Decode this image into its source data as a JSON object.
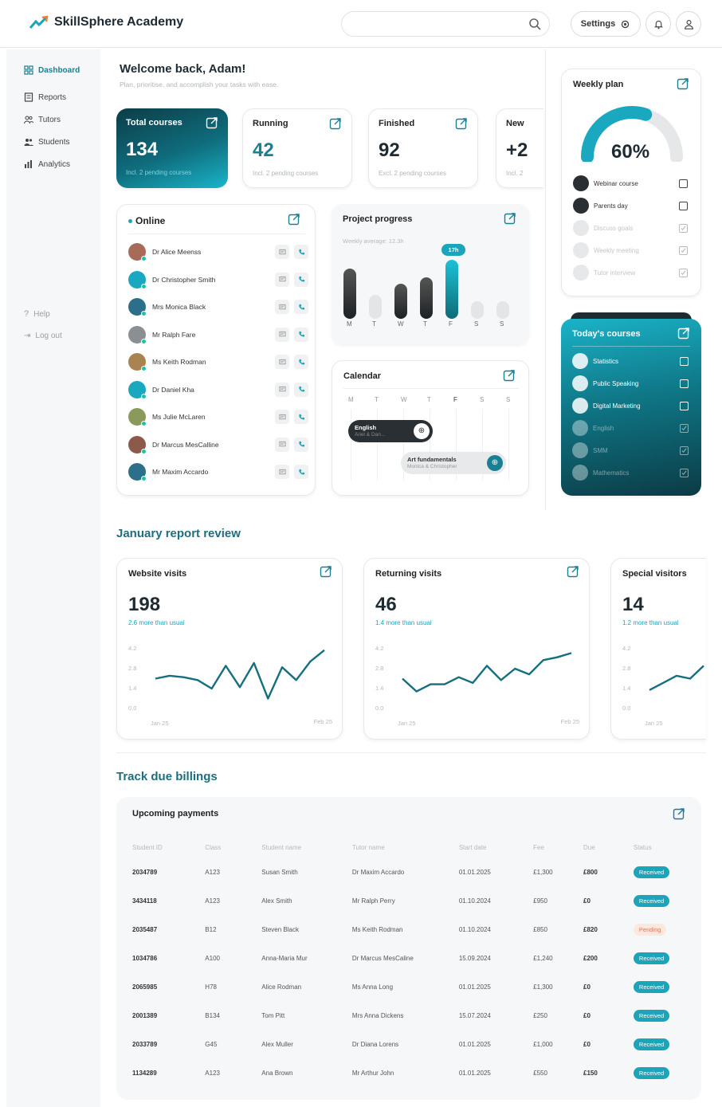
{
  "app": {
    "name": "SkillSphere Academy"
  },
  "header": {
    "settings_label": "Settings",
    "search_placeholder": ""
  },
  "sidebar": {
    "items": [
      {
        "label": "Dashboard",
        "icon": "grid-icon"
      },
      {
        "label": "Reports",
        "icon": "report-icon"
      },
      {
        "label": "Tutors",
        "icon": "tutors-icon"
      },
      {
        "label": "Students",
        "icon": "students-icon"
      },
      {
        "label": "Analytics",
        "icon": "analytics-icon"
      }
    ],
    "help": "Help",
    "logout": "Log out"
  },
  "welcome": {
    "title": "Welcome back, Adam!",
    "subtitle": "Plan, prioritise, and accomplish your tasks with ease."
  },
  "stats": [
    {
      "title": "Total courses",
      "value": "134",
      "sub": "Incl. 2 pending courses"
    },
    {
      "title": "Running",
      "value": "42",
      "sub": "Incl. 2 pending courses"
    },
    {
      "title": "Finished",
      "value": "92",
      "sub": "Excl. 2 pending courses"
    },
    {
      "title": "New",
      "value": "+2",
      "sub": "Incl. 2"
    }
  ],
  "online": {
    "title": "Online",
    "people": [
      {
        "name": "Dr Alice Meenss",
        "color": "#a86b5a"
      },
      {
        "name": "Dr Christopher Smith",
        "color": "#1aa8c0"
      },
      {
        "name": "Mrs Monica Black",
        "color": "#2b6f8a"
      },
      {
        "name": "Mr Ralph Fare",
        "color": "#8a8f93"
      },
      {
        "name": "Ms Keith Rodman",
        "color": "#a98350"
      },
      {
        "name": "Dr Daniel Kha",
        "color": "#1aa8c0"
      },
      {
        "name": "Ms Julie McLaren",
        "color": "#8a9a5a"
      },
      {
        "name": "Dr Marcus MesCalline",
        "color": "#8b5a4a"
      },
      {
        "name": "Mr Maxim Accardo",
        "color": "#2b6f8a"
      }
    ]
  },
  "project_progress": {
    "title": "Project progress",
    "subtitle": "Weekly average: 12.3h",
    "highlight": "17h",
    "days": [
      "M",
      "T",
      "W",
      "T",
      "F",
      "S",
      "S"
    ],
    "levels": [
      0.85,
      0.4,
      0.6,
      0.7,
      1.0,
      0.3,
      0.3
    ]
  },
  "calendar": {
    "title": "Calendar",
    "days": [
      "M",
      "T",
      "W",
      "T",
      "F",
      "S",
      "S"
    ],
    "events": [
      {
        "title": "English",
        "sub": "Ariel & Dan..."
      },
      {
        "title": "Art fundamentals",
        "sub": "Monica & Christopher"
      }
    ]
  },
  "weekly_plan": {
    "title": "Weekly plan",
    "percent_label": "60%",
    "percent": 60,
    "items": [
      {
        "label": "Webinar course",
        "done": false
      },
      {
        "label": "Parents day",
        "done": false
      },
      {
        "label": "Discuss goals",
        "done": true
      },
      {
        "label": "Weekly meeting",
        "done": true
      },
      {
        "label": "Tutor interview",
        "done": true
      }
    ]
  },
  "todays_courses": {
    "title": "Today's courses",
    "items": [
      {
        "label": "Statistics",
        "done": false
      },
      {
        "label": "Public Speaking",
        "done": false
      },
      {
        "label": "Digital Marketing",
        "done": false
      },
      {
        "label": "English",
        "done": true
      },
      {
        "label": "SMM",
        "done": true
      },
      {
        "label": "Mathematics",
        "done": true
      }
    ]
  },
  "report": {
    "title": "January report review",
    "cards": [
      {
        "title": "Website visits",
        "value": "198",
        "sub": "2.6 more than usual",
        "yticks": [
          "4.2",
          "2.8",
          "1.4",
          "0.0"
        ],
        "xstart": "Jan 25",
        "xend": "Feb 25",
        "points": [
          2.1,
          2.3,
          2.2,
          2.0,
          1.4,
          3.0,
          1.5,
          3.2,
          0.7,
          2.9,
          2.0,
          3.3,
          4.1
        ]
      },
      {
        "title": "Returning visits",
        "value": "46",
        "sub": "1.4 more than usual",
        "yticks": [
          "4.2",
          "2.8",
          "1.4",
          "0.0"
        ],
        "xstart": "Jan 25",
        "xend": "Feb 25",
        "points": [
          2.1,
          1.2,
          1.7,
          1.7,
          2.2,
          1.8,
          3.0,
          2.0,
          2.8,
          2.4,
          3.4,
          3.6,
          3.9
        ]
      },
      {
        "title": "Special visitors",
        "value": "14",
        "sub": "1.2 more than usual",
        "yticks": [
          "4.2",
          "2.8",
          "1.4",
          "0.0"
        ],
        "xstart": "Jan 25",
        "xend": "",
        "points": [
          1.3,
          1.8,
          2.3,
          2.1,
          3.0
        ]
      }
    ]
  },
  "billings": {
    "title": "Track due billings",
    "card_title": "Upcoming payments",
    "columns": [
      "Student ID",
      "Class",
      "Student name",
      "Tutor name",
      "Start date",
      "Fee",
      "Due",
      "Status"
    ],
    "rows": [
      [
        "2034789",
        "A123",
        "Susan Smith",
        "Dr Maxim Accardo",
        "01.01.2025",
        "£1,300",
        "£800",
        "Received"
      ],
      [
        "3434118",
        "A123",
        "Alex Smith",
        "Mr Ralph Perry",
        "01.10.2024",
        "£950",
        "£0",
        "Received"
      ],
      [
        "2035487",
        "B12",
        "Steven Black",
        "Ms Keith Rodman",
        "01.10.2024",
        "£850",
        "£820",
        "Pending"
      ],
      [
        "1034786",
        "A100",
        "Anna-Maria Mur",
        "Dr Marcus MesCaline",
        "15.09.2024",
        "£1,240",
        "£200",
        "Received"
      ],
      [
        "2065985",
        "H78",
        "Alice Rodman",
        "Ms Anna Long",
        "01.01.2025",
        "£1,300",
        "£0",
        "Received"
      ],
      [
        "2001389",
        "B134",
        "Tom Pitt",
        "Mrs Anna Dickens",
        "15.07.2024",
        "£250",
        "£0",
        "Received"
      ],
      [
        "2033789",
        "G45",
        "Alex Muller",
        "Dr Diana Lorens",
        "01.01.2025",
        "£1,000",
        "£0",
        "Received"
      ],
      [
        "1134289",
        "A123",
        "Ana Brown",
        "Mr Arthur John",
        "01.01.2025",
        "£550",
        "£150",
        "Received"
      ]
    ]
  },
  "colors": {
    "accent": "#1ba5ba",
    "dark_teal": "#0d4a56",
    "text": "#222222"
  }
}
